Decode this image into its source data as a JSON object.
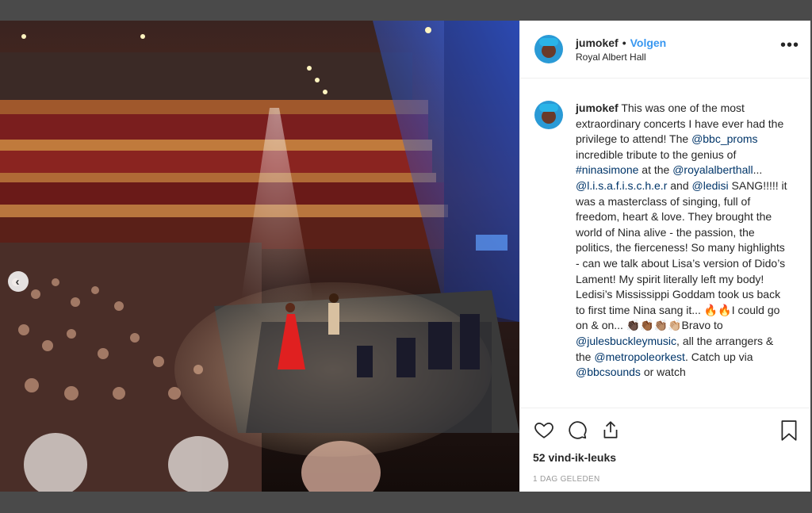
{
  "post": {
    "username": "jumokef",
    "separator": "•",
    "follow_label": "Volgen",
    "location": "Royal Albert Hall",
    "more_label": "•••",
    "carousel_prev": "‹",
    "caption": {
      "username": "jumokef",
      "t1": " This was one of the most extraordinary concerts I have ever had the privilege to attend! The ",
      "m1": "@bbc_proms",
      "t2": " incredible tribute to the genius of ",
      "h1": "#ninasimone",
      "t3": " at the ",
      "m2": "@royalalberthall",
      "t4": "... ",
      "m3": "@l.i.s.a.f.i.s.c.h.e.r",
      "t5": " and ",
      "m4": "@ledisi",
      "t6": " SANG!!!!! it was a masterclass of singing, full of freedom, heart & love. They brought the world of Nina alive - the passion, the politics, the fierceness! So many highlights - can we talk about Lisa’s version of Dido’s Lament! My spirit literally left my body! Ledisi’s Mississippi Goddam took us back to first time Nina sang it... 🔥🔥I could go on & on... 👏🏿👏🏾👏🏽👏🏼Bravo to ",
      "m5": "@julesbuckleymusic",
      "t7": ", all the arrangers & the ",
      "m6": "@metropoleorkest",
      "t8": ". Catch up via ",
      "m7": "@bbcsounds",
      "t9": " or watch"
    },
    "likes": "52 vind-ik-leuks",
    "date": "1 dag geleden"
  },
  "icons": [
    "heart-icon",
    "comment-icon",
    "share-icon",
    "bookmark-icon",
    "chevron-left-icon"
  ],
  "colors": {
    "link": "#003569",
    "follow": "#3897f0",
    "text": "#262626",
    "muted": "#999999",
    "frame": "#4a4a4a"
  }
}
